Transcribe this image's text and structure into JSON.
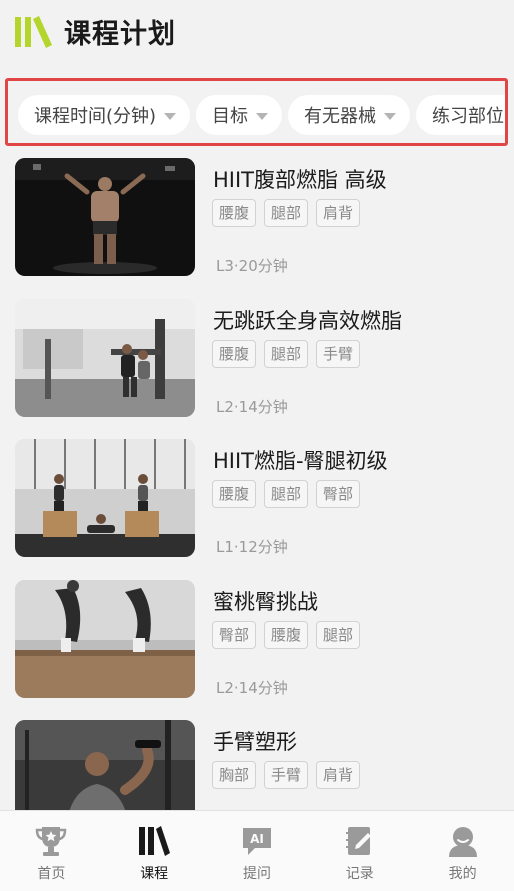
{
  "header": {
    "title": "课程计划",
    "logo_icon": "course-books-icon"
  },
  "filters": [
    {
      "label": "课程时间(分钟)"
    },
    {
      "label": "目标"
    },
    {
      "label": "有无器械"
    },
    {
      "label": "练习部位"
    }
  ],
  "courses": [
    {
      "title": "HIIT腹部燃脂 高级",
      "tags": [
        "腰腹",
        "腿部",
        "肩背"
      ],
      "meta": "L3·20分钟"
    },
    {
      "title": "无跳跃全身高效燃脂",
      "tags": [
        "腰腹",
        "腿部",
        "手臂"
      ],
      "meta": "L2·14分钟"
    },
    {
      "title": "HIIT燃脂-臀腿初级",
      "tags": [
        "腰腹",
        "腿部",
        "臀部"
      ],
      "meta": "L1·12分钟"
    },
    {
      "title": "蜜桃臀挑战",
      "tags": [
        "臀部",
        "腰腹",
        "腿部"
      ],
      "meta": "L2·14分钟"
    },
    {
      "title": "手臂塑形",
      "tags": [
        "胸部",
        "手臂",
        "肩背"
      ],
      "meta": ""
    }
  ],
  "tabbar": [
    {
      "label": "首页",
      "icon": "trophy-icon",
      "active": false
    },
    {
      "label": "课程",
      "icon": "course-books-icon",
      "active": true
    },
    {
      "label": "提问",
      "icon": "ai-chat-icon",
      "active": false
    },
    {
      "label": "记录",
      "icon": "notebook-icon",
      "active": false
    },
    {
      "label": "我的",
      "icon": "profile-icon",
      "active": false
    }
  ],
  "colors": {
    "brand_green": "#b4d52c",
    "highlight_red": "#e04646",
    "background": "#f2f2f2"
  }
}
